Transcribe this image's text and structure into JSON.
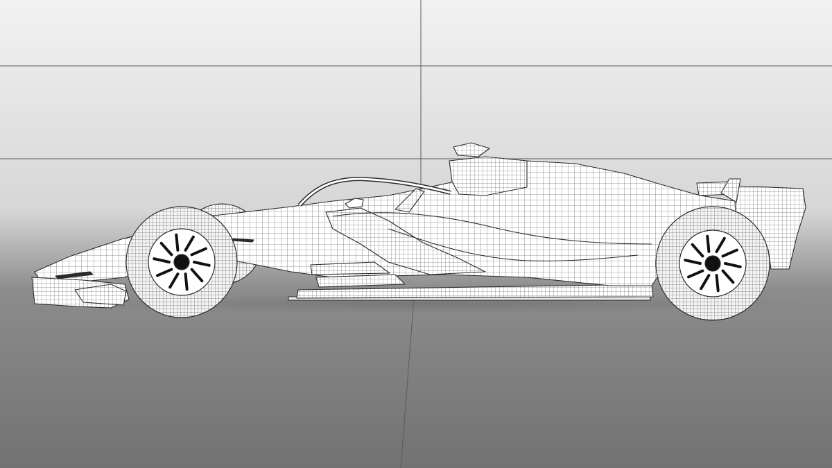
{
  "scene": {
    "subject": "formula-one-car-wireframe",
    "view": "side-profile",
    "background": {
      "top_color": "#f2f2f2",
      "mid_color": "#d6d6d6",
      "floor_color": "#8c8c8c",
      "floor_bottom_color": "#727272",
      "grid_line_color": "#5a5a5a"
    },
    "model": {
      "surface_color": "#ffffff",
      "wire_color": "#2a2a2a",
      "shadow_color": "#9a9a9a",
      "wheel_hub_color": "#111111"
    }
  }
}
